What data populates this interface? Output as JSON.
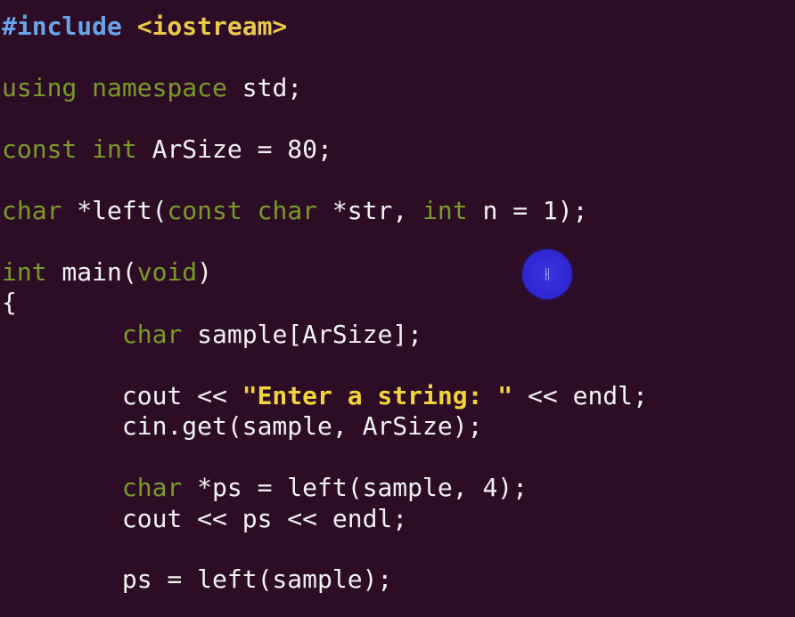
{
  "lines": [
    [
      [
        "tk-preproc",
        "#include"
      ],
      [
        "tk-plain",
        " "
      ],
      [
        "tk-header",
        "<iostream>"
      ]
    ],
    [
      [
        "tk-kw",
        "using"
      ],
      [
        "tk-plain",
        " "
      ],
      [
        "tk-kw",
        "namespace"
      ],
      [
        "tk-plain",
        " std;"
      ]
    ],
    [
      [
        "tk-kw",
        "const"
      ],
      [
        "tk-plain",
        " "
      ],
      [
        "tk-kw",
        "int"
      ],
      [
        "tk-plain",
        " ArSize = 80;"
      ]
    ],
    [
      [
        "tk-kw",
        "char"
      ],
      [
        "tk-plain",
        " *left("
      ],
      [
        "tk-kw",
        "const"
      ],
      [
        "tk-plain",
        " "
      ],
      [
        "tk-kw",
        "char"
      ],
      [
        "tk-plain",
        " *str, "
      ],
      [
        "tk-kw",
        "int"
      ],
      [
        "tk-plain",
        " n = 1);"
      ]
    ],
    [
      [
        "tk-kw",
        "int"
      ],
      [
        "tk-plain",
        " main("
      ],
      [
        "tk-kw",
        "void"
      ],
      [
        "tk-plain",
        ")"
      ]
    ],
    [
      [
        "tk-plain",
        "{"
      ]
    ],
    [
      [
        "tk-plain",
        "        "
      ],
      [
        "tk-kw",
        "char"
      ],
      [
        "tk-plain",
        " sample[ArSize];"
      ]
    ],
    [
      [
        "tk-plain",
        "        cout << "
      ],
      [
        "tk-str",
        "\"Enter a string: \""
      ],
      [
        "tk-plain",
        " << endl;"
      ]
    ],
    [
      [
        "tk-plain",
        "        cin.get(sample, ArSize);"
      ]
    ],
    [
      [
        "tk-plain",
        "        "
      ],
      [
        "tk-kw",
        "char"
      ],
      [
        "tk-plain",
        " *ps = left(sample, 4);"
      ]
    ],
    [
      [
        "tk-plain",
        "        cout << ps << endl;"
      ]
    ],
    [
      [
        "tk-plain",
        "        ps = left(sample);"
      ]
    ]
  ],
  "colors": {
    "background": "#2d0d26",
    "preprocessor": "#6aa4e8",
    "header": "#e9c84a",
    "keyword": "#7a9a27",
    "string": "#f2d33a",
    "text": "#f2f2f2",
    "cursor_highlight": "#3028d4"
  },
  "icons": {
    "mouse_cursor": "ibeam-cursor-icon"
  }
}
